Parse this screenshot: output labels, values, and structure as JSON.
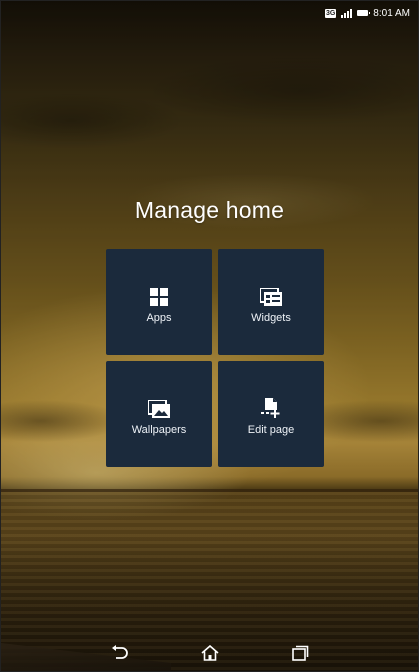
{
  "status_bar": {
    "network_badge": "3G",
    "time": "8:01 AM",
    "signal_icon": "signal-bars-icon",
    "battery_icon": "battery-icon"
  },
  "title": "Manage home",
  "tiles": [
    {
      "label": "Apps",
      "icon": "apps-grid-icon"
    },
    {
      "label": "Widgets",
      "icon": "widgets-icon"
    },
    {
      "label": "Wallpapers",
      "icon": "wallpaper-icon"
    },
    {
      "label": "Edit page",
      "icon": "edit-page-icon"
    }
  ],
  "nav_bar": {
    "back_icon": "back-icon",
    "home_icon": "home-icon",
    "recents_icon": "recents-icon"
  },
  "colors": {
    "tile_background": "#1b2a3c",
    "text": "#ffffff"
  }
}
